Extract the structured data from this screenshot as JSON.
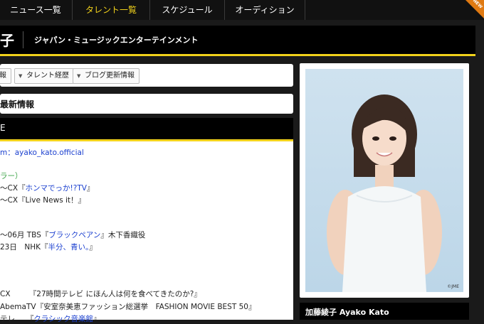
{
  "nav": {
    "items": [
      {
        "label": "ニュース一覧",
        "active": false
      },
      {
        "label": "タレント一覧",
        "active": true
      },
      {
        "label": "スケジュール",
        "active": false
      },
      {
        "label": "オーディション",
        "active": false
      }
    ],
    "ribbon_label": "NEW"
  },
  "header": {
    "name_fragment": "子",
    "agency": "ジャパン・ミュージックエンターテインメント"
  },
  "tabs": {
    "items": [
      {
        "label": "報"
      },
      {
        "label": "タレント経歴"
      },
      {
        "label": "ブログ更新情報"
      }
    ]
  },
  "latest": {
    "title": "最新情報"
  },
  "profile": {
    "head_char": "E",
    "lines": [
      {
        "t1": "m：",
        "t2": "ayako_kato.official",
        "t3": ""
      },
      {
        "t1": "ラー）",
        "t2": "",
        "t3": ""
      },
      {
        "t1": "〜CX『",
        "t2": "ホンマでっか!?TV",
        "t3": "』"
      },
      {
        "t1": "〜CX『Live News it！』",
        "t2": "",
        "t3": ""
      },
      {
        "t1": "〜06月 TBS『",
        "t2": "ブラックペアン",
        "t3": "』木下香織役"
      },
      {
        "t1": "23日　NHK『",
        "t2": "半分、青い。",
        "t3": "』"
      },
      {
        "t1": "CX　　　『27時間テレビ にほん人は何を食べてきたのか?』",
        "t2": "",
        "t3": ""
      },
      {
        "t1": "AbemaTV『安室奈美恵ファッション総選挙　FASHION MOVIE BEST 50』",
        "t2": "",
        "t3": ""
      },
      {
        "t1": "テレ　　『",
        "t2": "クラシック音楽館",
        "t3": "』"
      }
    ]
  },
  "photo": {
    "credit": "©JME"
  },
  "caption": {
    "name": "加藤綾子  Ayako Kato"
  },
  "colors": {
    "accent": "#f2d21b",
    "link": "#1a3fcf",
    "green": "#3aa345",
    "ribbon": "#e07a12"
  }
}
